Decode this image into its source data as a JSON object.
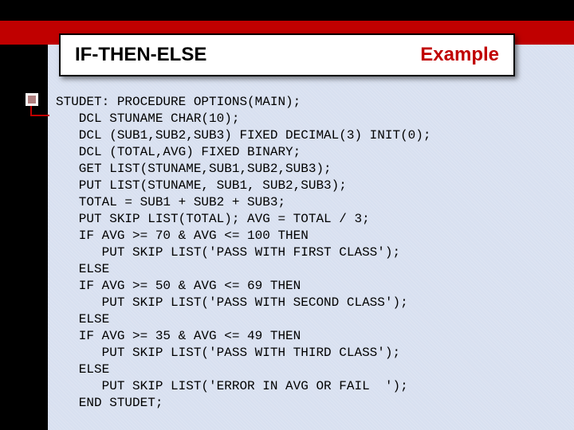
{
  "title_left": "IF-THEN-ELSE",
  "title_right": "Example",
  "code": "STUDET: PROCEDURE OPTIONS(MAIN);\n   DCL STUNAME CHAR(10);\n   DCL (SUB1,SUB2,SUB3) FIXED DECIMAL(3) INIT(0);\n   DCL (TOTAL,AVG) FIXED BINARY;\n   GET LIST(STUNAME,SUB1,SUB2,SUB3);\n   PUT LIST(STUNAME, SUB1, SUB2,SUB3);\n   TOTAL = SUB1 + SUB2 + SUB3;\n   PUT SKIP LIST(TOTAL); AVG = TOTAL / 3;\n   IF AVG >= 70 & AVG <= 100 THEN\n      PUT SKIP LIST('PASS WITH FIRST CLASS');\n   ELSE\n   IF AVG >= 50 & AVG <= 69 THEN\n      PUT SKIP LIST('PASS WITH SECOND CLASS');\n   ELSE\n   IF AVG >= 35 & AVG <= 49 THEN\n      PUT SKIP LIST('PASS WITH THIRD CLASS');\n   ELSE\n      PUT SKIP LIST('ERROR IN AVG OR FAIL  ');\n   END STUDET;"
}
